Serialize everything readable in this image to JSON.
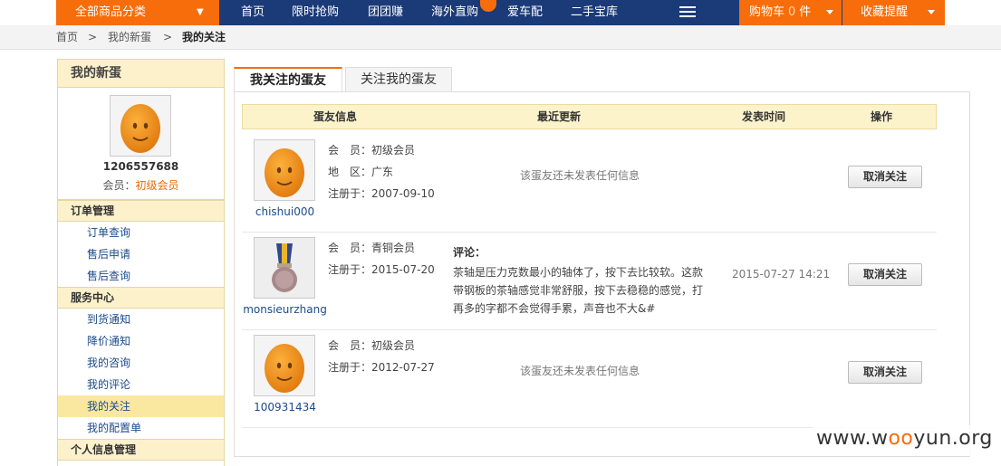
{
  "topnav": {
    "category_label": "全部商品分类",
    "items": [
      "首页",
      "限时抢购",
      "团团赚",
      "海外直购",
      "爱车配",
      "二手宝库"
    ],
    "cart_label": "购物车",
    "cart_count": "0",
    "cart_unit": "件",
    "favorites_label": "收藏提醒",
    "brand_color": "#1b3a78",
    "accent_color": "#f76d0b"
  },
  "breadcrumb": [
    "首页",
    "我的新蛋",
    "我的关注"
  ],
  "sidebar": {
    "title": "我的新蛋",
    "user_id": "1206557688",
    "member_prefix": "会员：",
    "member_level": "初级会员",
    "sections": [
      {
        "title": "订单管理",
        "items": [
          "订单查询",
          "售后申请",
          "售后查询"
        ]
      },
      {
        "title": "服务中心",
        "items": [
          "到货通知",
          "降价通知",
          "我的咨询",
          "我的评论",
          "我的关注",
          "我的配置单"
        ]
      },
      {
        "title": "个人信息管理",
        "items": []
      }
    ],
    "active_item": "我的关注"
  },
  "tabs": [
    "我关注的蛋友",
    "关注我的蛋友"
  ],
  "table": {
    "headers": [
      "蛋友信息",
      "最近更新",
      "发表时间",
      "操作"
    ],
    "rows": [
      {
        "username": "chishui000",
        "avatar": "egg-avatar",
        "member": "会　员：初级会员",
        "region": "地　区：广东",
        "registered": "注册于：2007-09-10",
        "update": "该蛋友还未发表任何信息",
        "time": "",
        "action": "取消关注"
      },
      {
        "username": "monsieurzhang",
        "avatar": "medal-avatar",
        "member": "会　员：青铜会员",
        "registered": "注册于：2015-07-20",
        "comment_title": "评论：",
        "comment": "茶轴是压力克数最小的轴体了，按下去比较软。这款带钢板的茶轴感觉非常舒服，按下去稳稳的感觉，打再多的字都不会觉得手累，声音也不大&#",
        "time": "2015-07-27 14:21",
        "action": "取消关注"
      },
      {
        "username": "100931434",
        "avatar": "egg-avatar",
        "member": "会　员：初级会员",
        "registered": "注册于：2012-07-27",
        "update": "该蛋友还未发表任何信息",
        "time": "",
        "action": "取消关注"
      }
    ]
  },
  "watermark": {
    "prefix": "www.w",
    "oo": "oo",
    "suffix": "yun.org"
  }
}
